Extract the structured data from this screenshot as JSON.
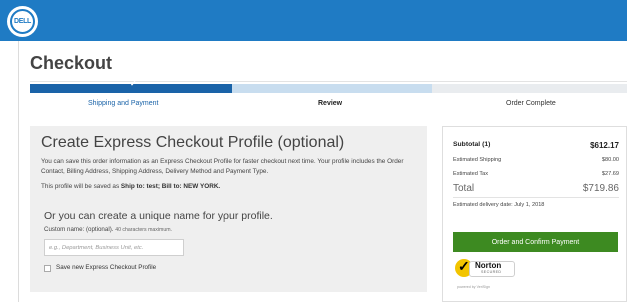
{
  "header": {
    "logo_text": "DELL",
    "logo_icon": "dell-logo",
    "background_color": "#1f7bc4"
  },
  "page": {
    "title": "Checkout"
  },
  "progress": {
    "steps": [
      {
        "label": "Shipping and Payment",
        "state": "complete"
      },
      {
        "label": "Review",
        "state": "current"
      },
      {
        "label": "Order Complete",
        "state": "upcoming"
      }
    ],
    "check_glyph": "✓",
    "complete_color": "#1a63a8",
    "current_color": "#c8ddef"
  },
  "express_profile": {
    "title": "Create Express Checkout Profile (optional)",
    "description": "You can save this order information as an Express Checkout Profile for faster checkout next time. Your profile includes the Order Contact, Billing Address, Shipping Address, Delivery Method and Payment Type.",
    "saved_as_prefix": "This profile will be saved as ",
    "saved_as_value": "Ship to: test; Bill to: NEW YORK.",
    "alt_title": "Or you can create a unique name for your profile.",
    "custom_name_label": "Custom name: (optional).",
    "custom_name_hint": "40 characters maximum.",
    "input_placeholder": "e.g., Department, Business Unit, etc.",
    "input_value": "",
    "checkbox_label": "Save new Express Checkout Profile",
    "checkbox_checked": false
  },
  "summary": {
    "subtotal_label": "Subtotal (1)",
    "subtotal_value": "$612.17",
    "shipping_label": "Estimated Shipping",
    "shipping_value": "$80.00",
    "tax_label": "Estimated Tax",
    "tax_value": "$27.69",
    "total_label": "Total",
    "total_value": "$719.86",
    "delivery_text": "Estimated delivery date: July 1, 2018",
    "confirm_button": "Order and Confirm Payment",
    "confirm_color": "#3d8a21"
  },
  "norton": {
    "icon": "norton-secured-seal",
    "name": "Norton",
    "secured": "SECURED",
    "powered_by": "powered by VeriSign"
  }
}
